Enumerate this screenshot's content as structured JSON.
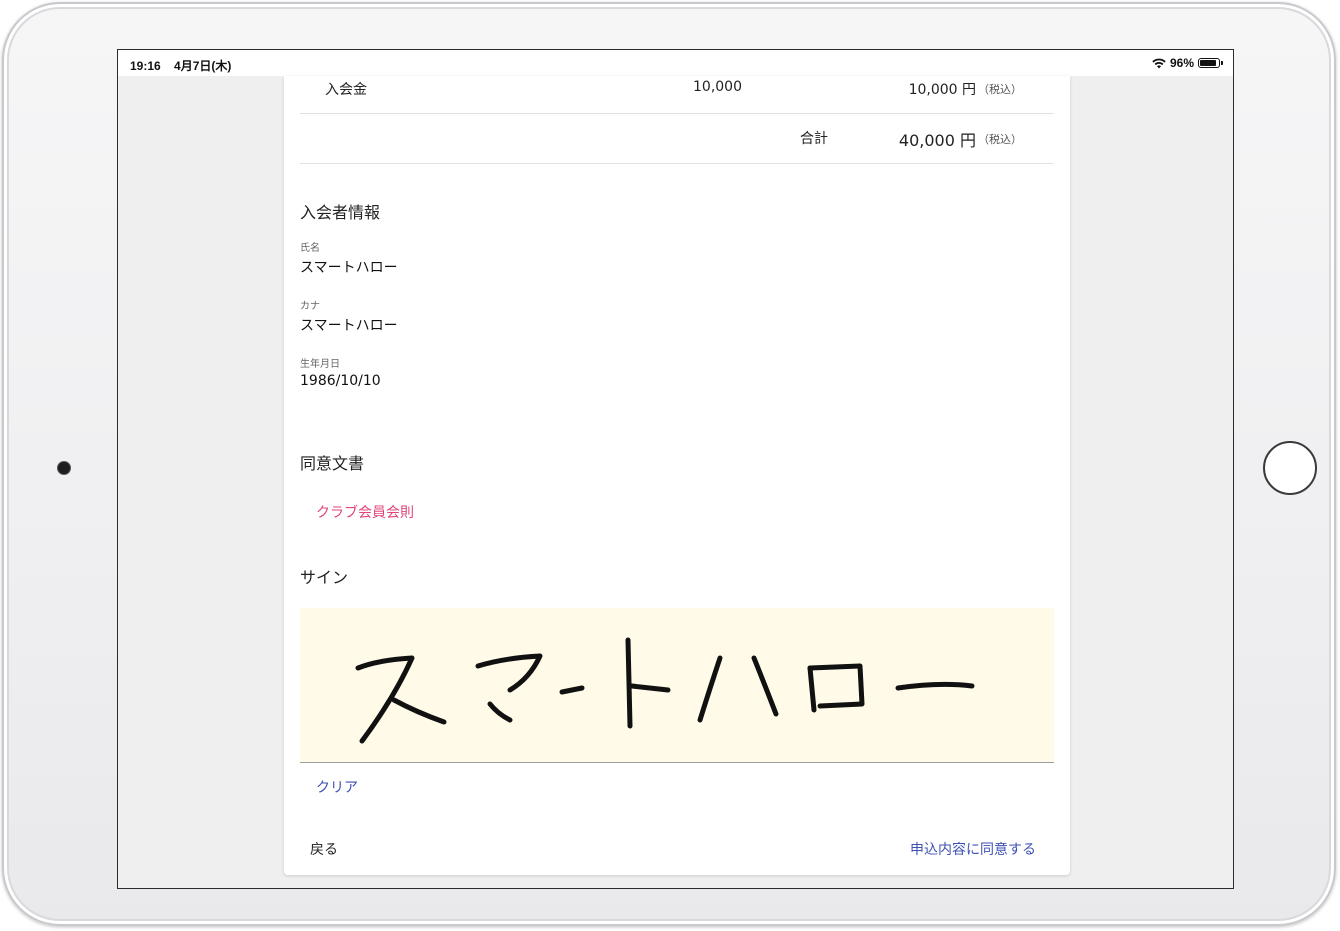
{
  "status_bar": {
    "time": "19:16",
    "date": "4月7日(木)",
    "battery_percent": "96%",
    "battery_level": 0.96,
    "wifi_icon": "wifi-icon",
    "battery_icon": "battery-icon"
  },
  "fees": {
    "rows": [
      {
        "name": "入会金",
        "quantity": "10,000",
        "amount": "10,000 円",
        "tax_note": "（税込）"
      }
    ],
    "total_label": "合計",
    "total_amount": "40,000 円",
    "total_tax_note": "（税込）"
  },
  "member_info": {
    "title": "入会者情報",
    "name_label": "氏名",
    "name_value": "スマートハロー",
    "kana_label": "カナ",
    "kana_value": "スマートハロー",
    "birthdate_label": "生年月日",
    "birthdate_value": "1986/10/10"
  },
  "consent": {
    "title": "同意文書",
    "documents": [
      "クラブ会員会則"
    ],
    "link_color": "#e0457b"
  },
  "signature": {
    "title": "サイン",
    "handwritten_text": "スマートハロー",
    "pad_color": "#fffbe8",
    "clear_label": "クリア"
  },
  "actions": {
    "back_label": "戻る",
    "agree_label": "申込内容に同意する",
    "accent_color": "#3f51b5"
  }
}
